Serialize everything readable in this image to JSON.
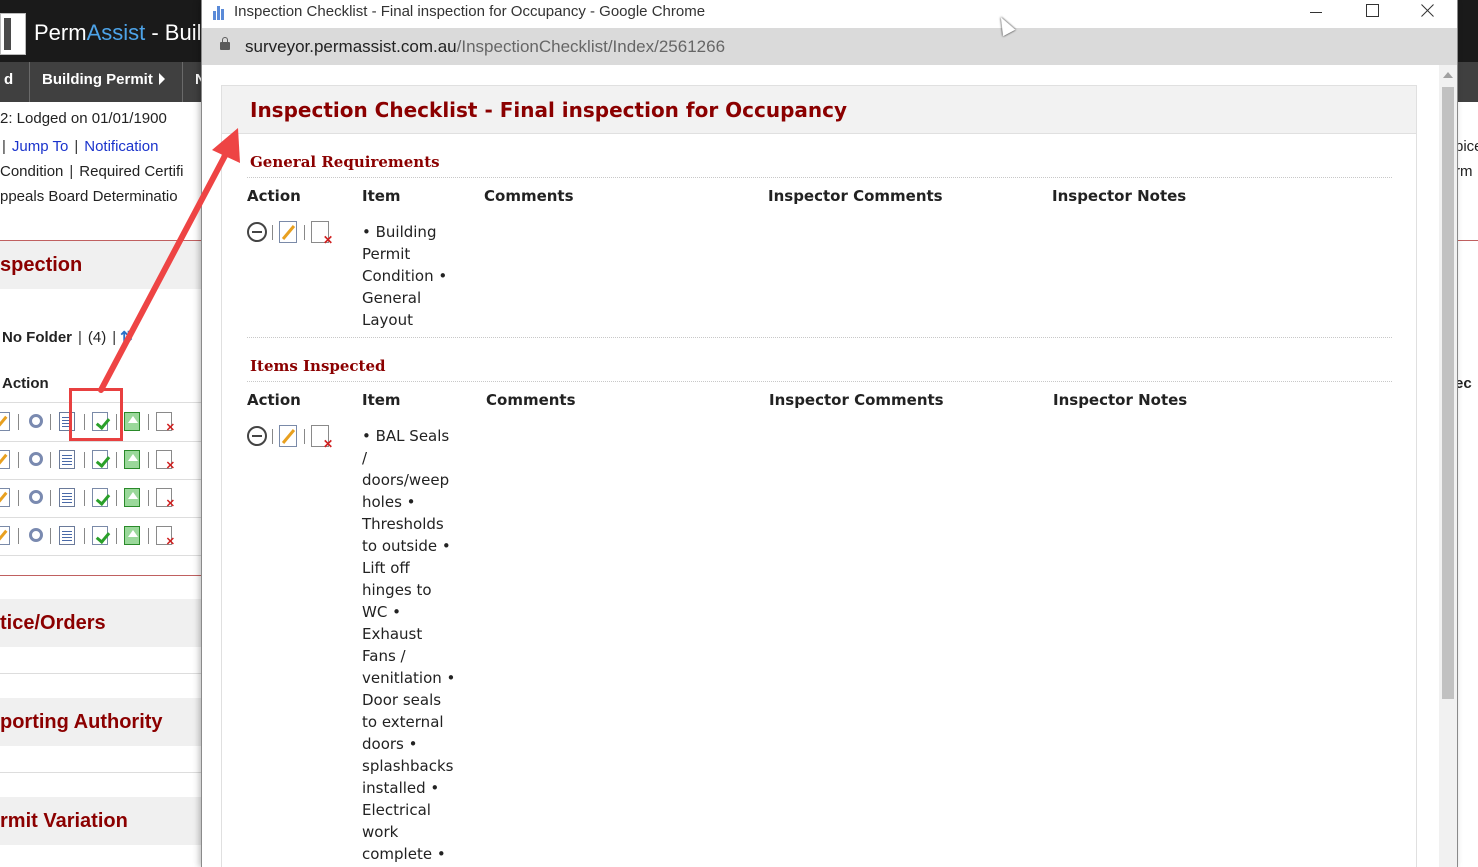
{
  "background_app": {
    "title_prefix": "Perm",
    "title_accent": "Assist",
    "title_suffix": " - Buil",
    "nav": [
      {
        "label": "d"
      },
      {
        "label": "Building Permit"
      },
      {
        "label": "N"
      }
    ],
    "lodged_text": "2: Lodged on 01/01/1900",
    "links": [
      "Jump To",
      "Notification"
    ],
    "line_condition": "Condition",
    "line_required": "Required Certifi",
    "line_appeals": "ppeals Board Determinatio",
    "right_text_1": "pice",
    "right_text_2": "rm",
    "right_text_3": "ec",
    "section_inspection": "spection",
    "folder_label": "No Folder",
    "folder_count": "(4)",
    "action_label": "Action",
    "section_notice": "tice/Orders",
    "section_reporting": "porting Authority",
    "section_variation": "rmit Variation"
  },
  "popup": {
    "window_title": "Inspection Checklist - Final inspection for Occupancy - Google Chrome",
    "url_host": "surveyor.permassist.com.au",
    "url_path": "/InspectionChecklist/Index/2561266",
    "page_title": "Inspection Checklist - Final inspection for Occupancy",
    "columns": [
      "Action",
      "Item",
      "Comments",
      "Inspector Comments",
      "Inspector Notes"
    ],
    "groups": [
      {
        "title": "General Requirements",
        "item": "• Building Permit Condition • General Layout"
      },
      {
        "title": "Items Inspected",
        "item": "• BAL Seals / doors/weep holes • Thresholds to outside • Lift off hinges to WC • Exhaust Fans / venitlation • Door seals to external doors • splashbacks installed • Electrical work complete •"
      }
    ]
  },
  "colors": {
    "heading": "#8b0000",
    "link": "#1a33cc",
    "annotation": "#e84040"
  },
  "icons": [
    "window-minimize-icon",
    "window-maximize-icon",
    "window-close-icon",
    "lock-icon",
    "remove-icon",
    "edit-icon",
    "delete-icon",
    "checklist-icon",
    "upload-icon",
    "sort-icon"
  ]
}
